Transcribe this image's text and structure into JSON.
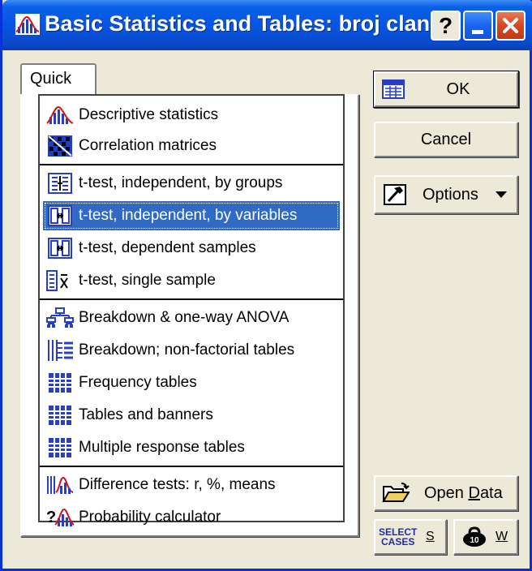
{
  "window": {
    "title": "Basic Statistics and Tables: broj clan",
    "help_label": "?"
  },
  "tabs": [
    {
      "label": "Quick"
    }
  ],
  "list_items": [
    {
      "label": "Descriptive statistics",
      "icon": "descriptive-stats-icon",
      "selected": false
    },
    {
      "label": "Correlation matrices",
      "icon": "correlation-matrix-icon",
      "selected": false
    },
    {
      "label": "t-test, independent, by groups",
      "icon": "t-test-groups-icon",
      "selected": false
    },
    {
      "label": "t-test, independent, by variables",
      "icon": "t-test-variables-icon",
      "selected": true
    },
    {
      "label": "t-test, dependent samples",
      "icon": "t-test-dependent-icon",
      "selected": false
    },
    {
      "label": "t-test, single sample",
      "icon": "t-test-single-icon",
      "selected": false
    },
    {
      "label": "Breakdown & one-way ANOVA",
      "icon": "breakdown-anova-icon",
      "selected": false
    },
    {
      "label": "Breakdown; non-factorial tables",
      "icon": "breakdown-nonfactorial-icon",
      "selected": false
    },
    {
      "label": "Frequency tables",
      "icon": "frequency-table-icon",
      "selected": false
    },
    {
      "label": "Tables and banners",
      "icon": "tables-banners-icon",
      "selected": false
    },
    {
      "label": "Multiple response tables",
      "icon": "multiple-response-icon",
      "selected": false
    },
    {
      "label": "Difference tests: r, %, means",
      "icon": "difference-tests-icon",
      "selected": false
    },
    {
      "label": "Probability calculator",
      "icon": "probability-calculator-icon",
      "selected": false
    }
  ],
  "buttons": {
    "ok": "OK",
    "cancel": "Cancel",
    "options": "Options",
    "open_data_pre": "Open ",
    "open_data_key": "D",
    "open_data_post": "ata",
    "select_cases_line1": "SELECT",
    "select_cases_line2": "CASES",
    "select_cases_key": "S",
    "weight_key": "W"
  },
  "colors": {
    "titlebar": "#0654e0",
    "selection": "#316ac5",
    "close_button": "#d9461e",
    "window_bg": "#ece9d8"
  }
}
